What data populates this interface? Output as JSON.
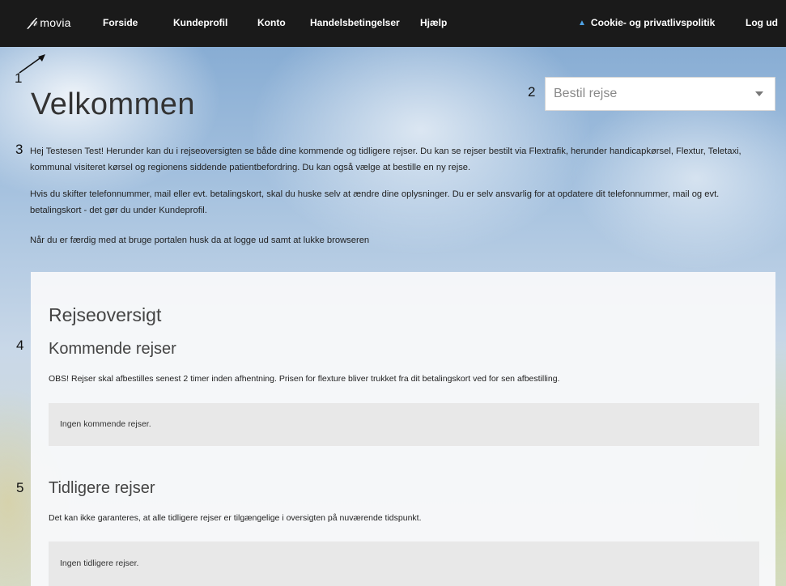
{
  "nav": {
    "brand": "movia",
    "items": [
      "Forside",
      "Kundeprofil",
      "Konto",
      "Handelsbetingelser",
      "Hjælp"
    ],
    "cookie": "Cookie- og privatlivspolitik",
    "logout": "Log ud"
  },
  "annotations": [
    "1",
    "2",
    "3",
    "4",
    "5"
  ],
  "order_select": {
    "value": "Bestil rejse"
  },
  "welcome": {
    "title": "Velkommen",
    "para1": "Hej Testesen Test! Herunder kan du i rejseoversigten se både dine kommende og tidligere rejser. Du kan se rejser bestilt via Flextrafik, herunder handicapkørsel, Flextur, Teletaxi, kommunal visiteret kørsel og regionens siddende patientbefordring. Du kan også vælge at bestille en ny rejse.",
    "para2": "Hvis du skifter telefonnummer, mail eller evt. betalingskort, skal du huske selv at ændre dine oplysninger. Du er selv ansvarlig for at opdatere dit telefonnummer, mail og evt. betalingskort - det gør du under Kundeprofil.",
    "para3": "Når du er færdig med at bruge portalen husk da at logge ud samt at lukke browseren"
  },
  "overview": {
    "title": "Rejseoversigt",
    "upcoming": {
      "title": "Kommende rejser",
      "note": "OBS! Rejser skal afbestilles senest 2 timer inden afhentning. Prisen for flexture bliver trukket fra dit betalingskort ved for sen afbestilling.",
      "empty": "Ingen kommende rejser."
    },
    "past": {
      "title": "Tidligere rejser",
      "note": "Det kan ikke garanteres, at alle tidligere rejser er tilgængelige i oversigten på nuværende tidspunkt.",
      "empty": "Ingen tidligere rejser."
    }
  },
  "colors": {
    "navbar": "#1a1a1a",
    "cookie_icon": "#4fa3e6"
  }
}
